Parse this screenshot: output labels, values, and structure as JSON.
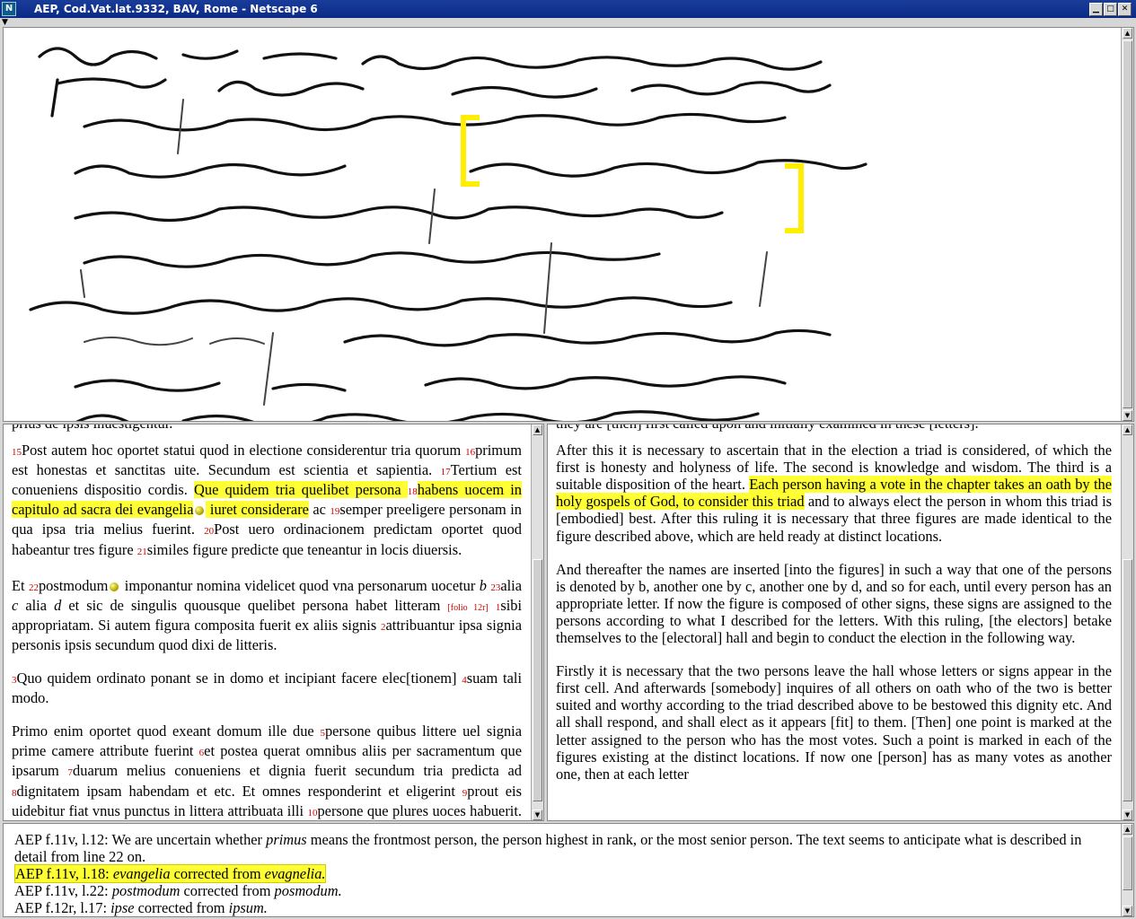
{
  "window": {
    "title": "AEP, Cod.Vat.lat.9332, BAV, Rome - Netscape 6",
    "app_icon": "N",
    "minimize_glyph": "▁",
    "maximize_glyph": "□",
    "close_glyph": "✕",
    "menu_glyph": "▼"
  },
  "latin": {
    "top_cut": "prius de ipsis inuestigentur.",
    "p1": [
      {
        "n": "15",
        "t": "Post autem hoc oportet statui quod in electione considerentur tria quorum "
      },
      {
        "n": "16",
        "t": "primum est honestas et sanctitas uite. Secundum est scientia et sapientia. "
      },
      {
        "n": "17",
        "t": "Tertium est conueniens dispositio cordis. "
      },
      {
        "hl": "Que quidem tria quelibet persona "
      },
      {
        "n": "18",
        "hl": "habens uocem in capitulo ad sacra dei evangelia"
      },
      {
        "dot": true
      },
      {
        "hl": " iuret considerare"
      },
      {
        "t": " ac "
      },
      {
        "n": "19",
        "t": "semper preeligere personam in qua ipsa tria melius fuerint. "
      },
      {
        "n": "20",
        "t": "Post uero ordinacionem predictam oportet quod habeantur tres figure "
      },
      {
        "n": "21",
        "t": "similes figure predicte que teneantur in locis diuersis."
      }
    ],
    "p2": [
      {
        "t": "Et "
      },
      {
        "n": "22",
        "t": "postmodum"
      },
      {
        "dot": true
      },
      {
        "t": " imponantur nomina videlicet quod vna personarum uocetur "
      },
      {
        "i": "b"
      },
      {
        "t": " "
      },
      {
        "n": "23",
        "t": "alia "
      },
      {
        "i": "c"
      },
      {
        "t": " alia "
      },
      {
        "i": "d"
      },
      {
        "t": " et sic de singulis quousque quelibet persona habet litteram "
      },
      {
        "f": "[folio 12r]"
      },
      {
        "t": " "
      },
      {
        "n": "1",
        "t": "sibi appropriatam. Si autem figura composita fuerit ex aliis signis "
      },
      {
        "n": "2",
        "t": "attribuantur ipsa signia personis ipsis secundum quod dixi de litteris."
      }
    ],
    "p3": [
      {
        "n": "3",
        "t": "Quo quidem ordinato ponant se in domo et incipiant facere elec[tionem] "
      },
      {
        "n": "4",
        "t": "suam tali modo."
      }
    ],
    "p4": [
      {
        "t": "Primo enim oportet quod exeant domum ille due "
      },
      {
        "n": "5",
        "t": "persone quibus littere uel signia prime camere attribute fuerint "
      },
      {
        "n": "6",
        "t": "et postea querat omnibus aliis per sacramentum que ipsarum "
      },
      {
        "n": "7",
        "t": "duarum melius conueniens et dignia fuerit secundum tria predicta ad "
      },
      {
        "n": "8",
        "t": "dignitatem ipsam habendam et etc. Et omnes responderint et eligerint "
      },
      {
        "n": "9",
        "t": "prout eis uidebitur fiat vnus punctus in littera attribuata illi "
      },
      {
        "n": "10",
        "t": "persone que plures uoces habuerit. Qui punctus fiat ipsi"
      }
    ]
  },
  "english": {
    "top_cut": "they are [then] first called upon and initially examined in these [letters].",
    "p1_pre": "After this it is necessary to ascertain that in the election a triad is considered, of which the first is honesty and holyness of life. The second is knowledge and wisdom. The third is a suitable disposition of the heart. ",
    "p1_hl": "Each person having a vote in the chapter takes an oath by the holy gospels of God, to consider this triad",
    "p1_post": " and to always elect the person in whom this triad is [embodied] best. After this ruling it is necessary that three figures are made identical to the figure described above, which are held ready at distinct locations.",
    "p2": "And thereafter the names are inserted [into the figures] in such a way that one of the persons is denoted by b, another one by c, another one by d, and so for each, until every person has an appropriate letter. If now the figure is composed of other signs, these signs are assigned to the persons according to what I described for the letters. With this ruling, [the electors] betake themselves to the [electoral] hall and begin to conduct the election in the following way.",
    "p3": "Firstly it is necessary that the two persons leave the hall whose letters or signs appear in the first cell. And afterwards [somebody] inquires of all others on oath who of the two is better suited and worthy according to the triad described above to be bestowed this dignity etc. And all shall respond, and shall elect as it appears [fit] to them. [Then] one point is marked at the letter assigned to the person who has the most votes. Such a point is marked in each of the figures existing at the distinct locations. If now one [person] has as many votes as another one, then at each letter"
  },
  "notes": {
    "n1_ref": "AEP f.11v, l.12:",
    "n1_a": " We are uncertain whether ",
    "n1_i": "primus",
    "n1_b": " means the frontmost person, the person highest in rank, or the most senior person. The text seems to anticipate what is described in detail from line 22 on.",
    "n2_ref": "AEP f.11v, l.18:",
    "n2_i1": "evangelia",
    "n2_a": " corrected from ",
    "n2_i2": "evagnelia.",
    "n3_ref": "AEP f.11v, l.22:",
    "n3_i1": "postmodum",
    "n3_a": " corrected from ",
    "n3_i2": "posmodum.",
    "n4_ref": "AEP f.12r, l.17:",
    "n4_i1": "ipse",
    "n4_a": " corrected from ",
    "n4_i2": "ipsum."
  }
}
